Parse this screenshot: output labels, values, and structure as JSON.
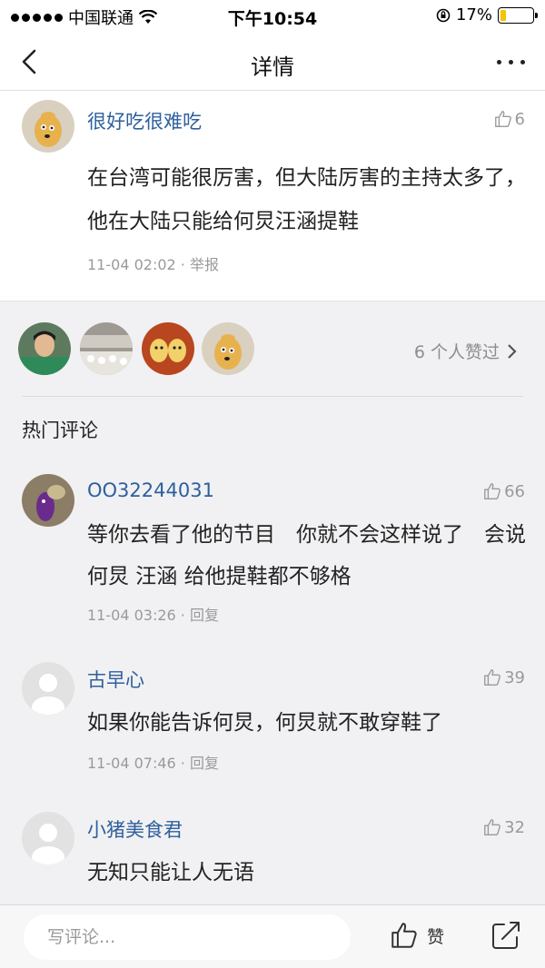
{
  "status_bar": {
    "carrier": "中国联通",
    "time": "下午10:54",
    "battery_percent": "17%",
    "battery_level": 0.17
  },
  "nav": {
    "title": "详情"
  },
  "main_comment": {
    "user": "很好吃很难吃",
    "likes": "6",
    "text": "在台湾可能很厉害，但大陆厉害的主持太多了，他在大陆只能给何炅汪涵提鞋",
    "time": "11-04 02:02",
    "report": "举报"
  },
  "likers": {
    "summary": "6 个人赞过"
  },
  "hot_section": {
    "title": "热门评论",
    "comments": [
      {
        "user": "OO32244031",
        "likes": "66",
        "text": "等你去看了他的节目　你就不会这样说了　会说何炅 汪涵 给他提鞋都不够格",
        "time": "11-04 03:26",
        "reply": "回复"
      },
      {
        "user": "古早心",
        "likes": "39",
        "text": "如果你能告诉何炅，何炅就不敢穿鞋了",
        "time": "11-04 07:46",
        "reply": "回复"
      },
      {
        "user": "小猪美食君",
        "likes": "32",
        "text": "无知只能让人无语",
        "time": "",
        "reply": ""
      }
    ]
  },
  "bottom_bar": {
    "placeholder": "写评论...",
    "like_label": "赞"
  },
  "colors": {
    "username": "#2e5f9c",
    "meta": "#9a9a9a",
    "battery": "#f5c400"
  }
}
